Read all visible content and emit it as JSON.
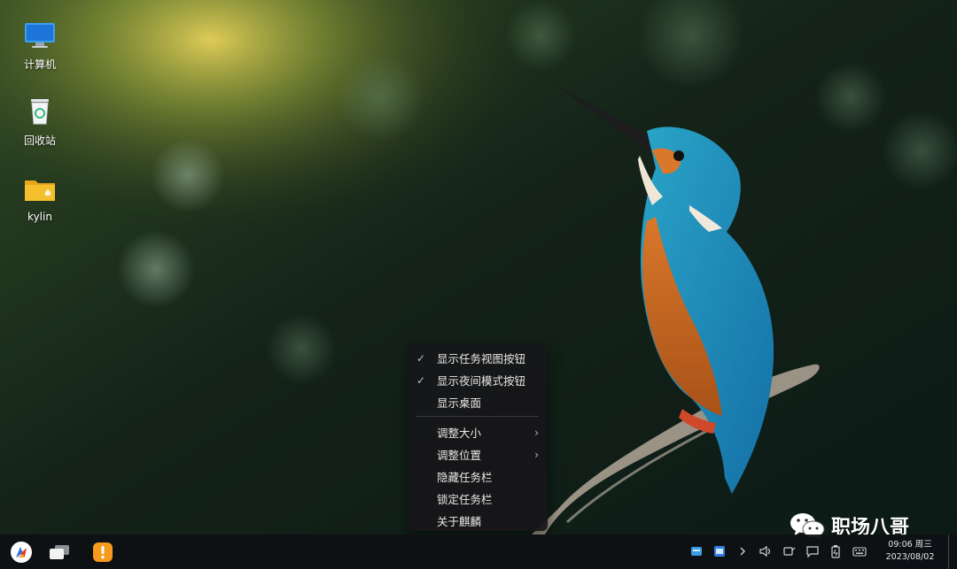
{
  "desktop": {
    "icons": [
      {
        "label": "计算机",
        "icon": "computer-icon"
      },
      {
        "label": "回收站",
        "icon": "recycle-bin-icon"
      },
      {
        "label": "kylin",
        "icon": "home-folder-icon"
      }
    ]
  },
  "context_menu": {
    "items": [
      {
        "label": "显示任务视图按钮",
        "checked": true
      },
      {
        "label": "显示夜间模式按钮",
        "checked": true
      },
      {
        "label": "显示桌面",
        "checked": false
      },
      {
        "label": "调整大小",
        "submenu": true
      },
      {
        "label": "调整位置",
        "submenu": true
      },
      {
        "label": "隐藏任务栏"
      },
      {
        "label": "锁定任务栏"
      },
      {
        "label": "关于麒麟"
      }
    ],
    "check_glyph": "✓",
    "submenu_glyph": "›"
  },
  "watermark": {
    "text": "职场八哥"
  },
  "taskbar": {
    "buttons": [
      "start-menu-icon",
      "task-view-icon",
      "app-store-icon"
    ],
    "tray": [
      "tray-app-icon-1",
      "tray-app-icon-2",
      "expand-tray-icon",
      "volume-icon",
      "network-icon",
      "notification-icon",
      "battery-icon",
      "keyboard-icon"
    ],
    "clock": {
      "time": "09:06 周三",
      "date": "2023/08/02"
    }
  },
  "colors": {
    "taskbar_bg": "#0e1014",
    "menu_bg": "#161618",
    "folder_yellow": "#f5c02e",
    "start_blue": "#2b6fe0"
  }
}
